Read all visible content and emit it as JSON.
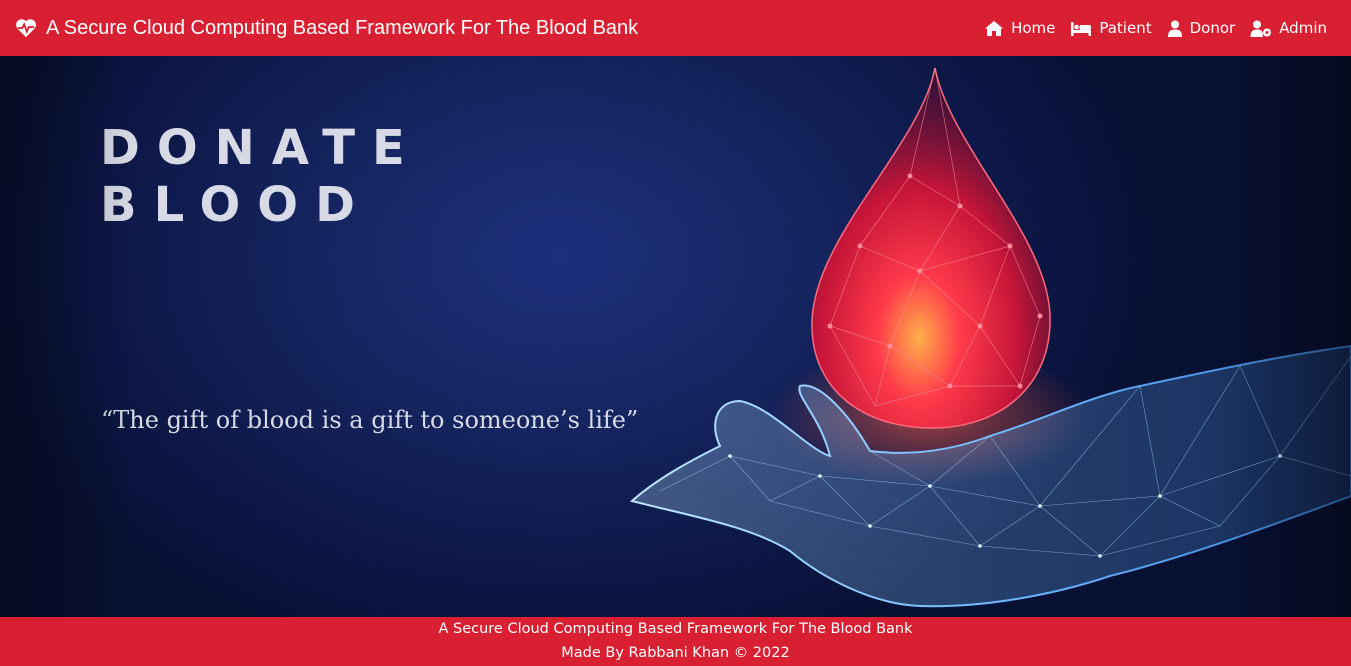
{
  "navbar": {
    "brand_icon": "heart-pulse-icon",
    "brand_title": "A Secure Cloud Computing Based Framework For The Blood Bank",
    "links": [
      {
        "label": "Home",
        "icon": "home-icon"
      },
      {
        "label": "Patient",
        "icon": "bed-icon"
      },
      {
        "label": "Donor",
        "icon": "user-icon"
      },
      {
        "label": "Admin",
        "icon": "user-cog-icon"
      }
    ]
  },
  "hero": {
    "title_line1": "DONATE",
    "title_line2": "BLOOD",
    "quote": "“The gift of blood is a gift to someone’s life”"
  },
  "footer": {
    "line1": "A Secure Cloud Computing Based Framework For The Blood Bank",
    "line2": "Made By Rabbani Khan © 2022"
  },
  "colors": {
    "brand_red": "#d92032",
    "hero_navy": "#152560"
  }
}
